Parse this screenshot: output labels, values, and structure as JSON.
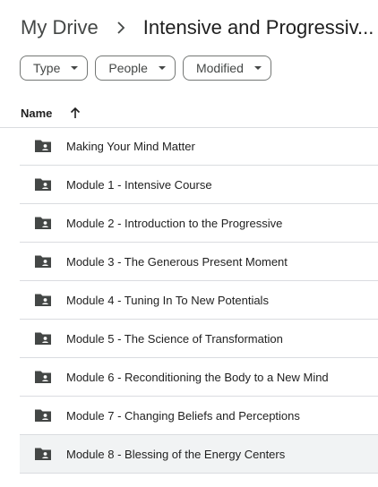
{
  "breadcrumb": {
    "root": "My Drive",
    "current": "Intensive and Progressiv..."
  },
  "filters": {
    "type": "Type",
    "people": "People",
    "modified": "Modified"
  },
  "columns": {
    "name": "Name"
  },
  "items": [
    {
      "label": "Making Your Mind Matter"
    },
    {
      "label": "Module 1 - Intensive Course"
    },
    {
      "label": "Module 2 - Introduction to the Progressive"
    },
    {
      "label": "Module 3 - The Generous Present Moment"
    },
    {
      "label": "Module 4 - Tuning In To New Potentials"
    },
    {
      "label": "Module 5 - The Science of Transformation"
    },
    {
      "label": "Module 6 - Reconditioning the Body to a New Mind"
    },
    {
      "label": "Module 7 - Changing Beliefs and Perceptions"
    },
    {
      "label": "Module 8 - Blessing of the Energy Centers",
      "selected": true
    }
  ],
  "icons": {
    "folder": "shared-folder-icon",
    "separator": "chevron-right-icon",
    "dropdown": "caret-down-icon",
    "sort": "arrow-up-icon"
  },
  "colors": {
    "folder_icon": "#444746",
    "selected_row": "#f1f3f4",
    "divider": "#dadce0"
  }
}
